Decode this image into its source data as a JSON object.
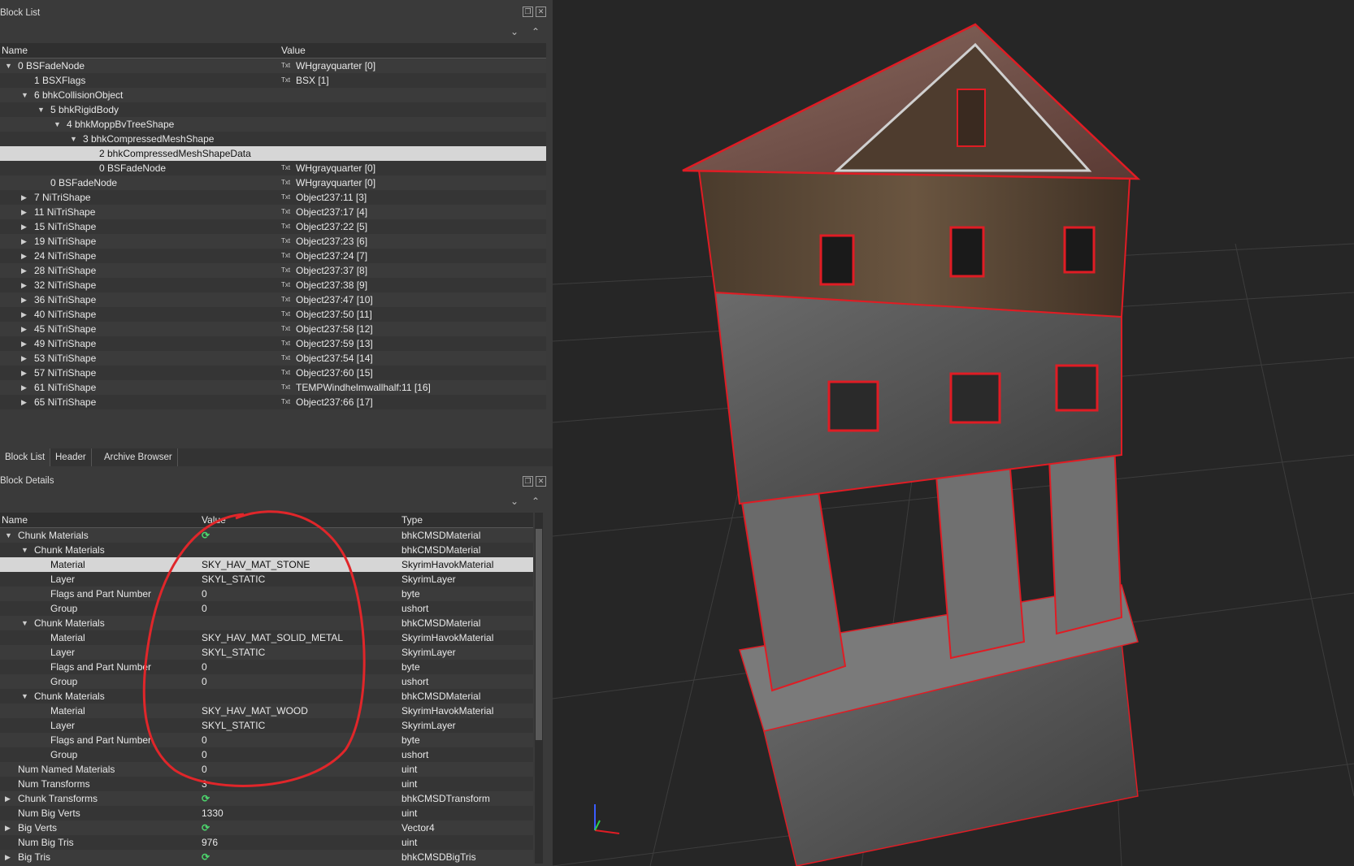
{
  "block_list": {
    "title": "Block List",
    "columns": {
      "name": "Name",
      "value": "Value"
    },
    "rows": [
      {
        "name": "0 BSFadeNode",
        "value": "WHgrayquarter [0]"
      },
      {
        "name": "1 BSXFlags",
        "value": "BSX [1]"
      },
      {
        "name": "6 bhkCollisionObject",
        "value": ""
      },
      {
        "name": "5 bhkRigidBody",
        "value": ""
      },
      {
        "name": "4 bhkMoppBvTreeShape",
        "value": ""
      },
      {
        "name": "3 bhkCompressedMeshShape",
        "value": ""
      },
      {
        "name": "2 bhkCompressedMeshShapeData",
        "value": ""
      },
      {
        "name": "0 BSFadeNode",
        "value": "WHgrayquarter [0]"
      },
      {
        "name": "0 BSFadeNode",
        "value": "WHgrayquarter [0]"
      },
      {
        "name": "7 NiTriShape",
        "value": "Object237:11 [3]"
      },
      {
        "name": "11 NiTriShape",
        "value": "Object237:17 [4]"
      },
      {
        "name": "15 NiTriShape",
        "value": "Object237:22 [5]"
      },
      {
        "name": "19 NiTriShape",
        "value": "Object237:23 [6]"
      },
      {
        "name": "24 NiTriShape",
        "value": "Object237:24 [7]"
      },
      {
        "name": "28 NiTriShape",
        "value": "Object237:37 [8]"
      },
      {
        "name": "32 NiTriShape",
        "value": "Object237:38 [9]"
      },
      {
        "name": "36 NiTriShape",
        "value": "Object237:47 [10]"
      },
      {
        "name": "40 NiTriShape",
        "value": "Object237:50 [11]"
      },
      {
        "name": "45 NiTriShape",
        "value": "Object237:58 [12]"
      },
      {
        "name": "49 NiTriShape",
        "value": "Object237:59 [13]"
      },
      {
        "name": "53 NiTriShape",
        "value": "Object237:54 [14]"
      },
      {
        "name": "57 NiTriShape",
        "value": "Object237:60 [15]"
      },
      {
        "name": "61 NiTriShape",
        "value": "TEMPWindhelmwallhalf:11 [16]"
      },
      {
        "name": "65 NiTriShape",
        "value": "Object237:66 [17]"
      }
    ]
  },
  "tabs": [
    "Block List",
    "Header",
    "Archive Browser"
  ],
  "block_details": {
    "title": "Block Details",
    "columns": {
      "name": "Name",
      "value": "Value",
      "type": "Type"
    },
    "rows": [
      {
        "name": "Chunk Materials",
        "value": "",
        "type": "bhkCMSDMaterial"
      },
      {
        "name": "Chunk Materials",
        "value": "",
        "type": "bhkCMSDMaterial"
      },
      {
        "name": "Material",
        "value": "SKY_HAV_MAT_STONE",
        "type": "SkyrimHavokMaterial"
      },
      {
        "name": "Layer",
        "value": "SKYL_STATIC",
        "type": "SkyrimLayer"
      },
      {
        "name": "Flags and Part Number",
        "value": "0",
        "type": "byte"
      },
      {
        "name": "Group",
        "value": "0",
        "type": "ushort"
      },
      {
        "name": "Chunk Materials",
        "value": "",
        "type": "bhkCMSDMaterial"
      },
      {
        "name": "Material",
        "value": "SKY_HAV_MAT_SOLID_METAL",
        "type": "SkyrimHavokMaterial"
      },
      {
        "name": "Layer",
        "value": "SKYL_STATIC",
        "type": "SkyrimLayer"
      },
      {
        "name": "Flags and Part Number",
        "value": "0",
        "type": "byte"
      },
      {
        "name": "Group",
        "value": "0",
        "type": "ushort"
      },
      {
        "name": "Chunk Materials",
        "value": "",
        "type": "bhkCMSDMaterial"
      },
      {
        "name": "Material",
        "value": "SKY_HAV_MAT_WOOD",
        "type": "SkyrimHavokMaterial"
      },
      {
        "name": "Layer",
        "value": "SKYL_STATIC",
        "type": "SkyrimLayer"
      },
      {
        "name": "Flags and Part Number",
        "value": "0",
        "type": "byte"
      },
      {
        "name": "Group",
        "value": "0",
        "type": "ushort"
      },
      {
        "name": "Num Named Materials",
        "value": "0",
        "type": "uint"
      },
      {
        "name": "Num Transforms",
        "value": "3",
        "type": "uint"
      },
      {
        "name": "Chunk Transforms",
        "value": "",
        "type": "bhkCMSDTransform"
      },
      {
        "name": "Num Big Verts",
        "value": "1330",
        "type": "uint"
      },
      {
        "name": "Big Verts",
        "value": "",
        "type": "Vector4"
      },
      {
        "name": "Num Big Tris",
        "value": "976",
        "type": "uint"
      },
      {
        "name": "Big Tris",
        "value": "",
        "type": "bhkCMSDBigTris"
      }
    ]
  },
  "colors": {
    "annotation": "#e0262a",
    "wireframe": "#e01c24",
    "selection": "#d6d6d6"
  }
}
